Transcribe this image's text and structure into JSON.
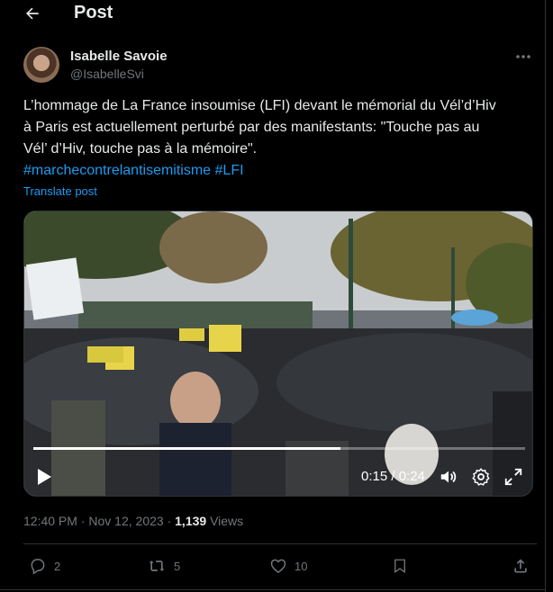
{
  "header": {
    "title": "Post"
  },
  "author": {
    "name": "Isabelle Savoie",
    "handle": "@IsabelleSvi"
  },
  "tweet": {
    "text_line1": "L’hommage de La France insoumise (LFI) devant le mémorial du Vél’d’Hiv",
    "text_line2": "à Paris est actuellement perturbé par des manifestants: \"Touche pas au",
    "text_line3": "Vél’ d’Hiv, touche pas à la mémoire\".",
    "hashtag1": "#marchecontrelantisemitisme",
    "hashtag2": "#LFI",
    "translate": "Translate post"
  },
  "video": {
    "time": "0:15 / 0:24",
    "progress": 0.625
  },
  "meta": {
    "time": "12:40 PM",
    "dot1": " · ",
    "date": "Nov 12, 2023",
    "dot2": " · ",
    "views_count": "1,139",
    "views_label": " Views"
  },
  "actions": {
    "replies": "2",
    "reposts": "5",
    "likes": "10"
  },
  "icons": [
    "back-arrow-icon",
    "more-icon",
    "play-icon",
    "volume-icon",
    "settings-icon",
    "fullscreen-icon",
    "reply-icon",
    "repost-icon",
    "like-icon",
    "bookmark-icon",
    "share-icon"
  ],
  "colors": {
    "background": "#000000",
    "text": "#e7e9ea",
    "muted": "#71767b",
    "accent": "#1d9bf0",
    "divider": "#2f3336"
  }
}
